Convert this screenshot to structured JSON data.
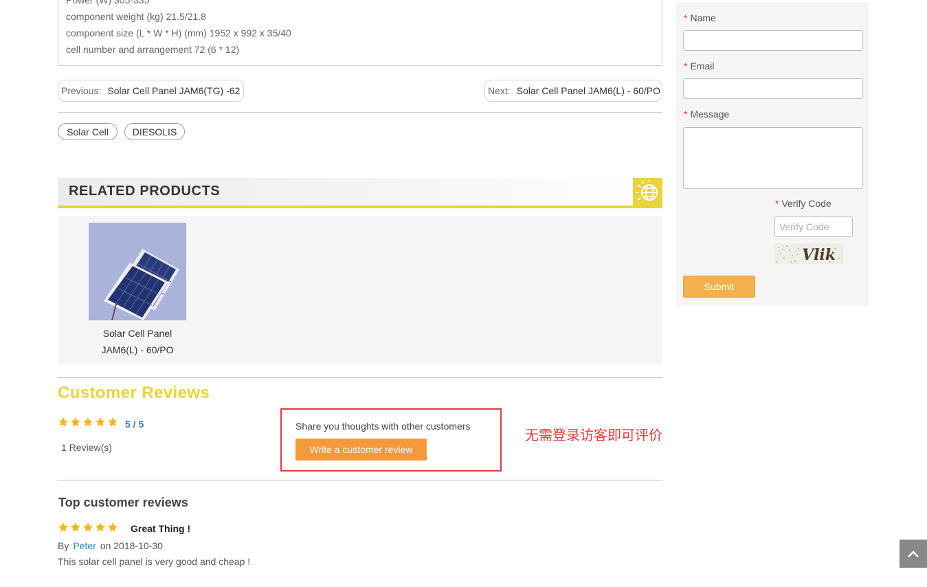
{
  "specs": [
    "Power (W) 305-335",
    "component weight (kg) 21.5/21.8",
    "component size (L * W * H) (mm) 1952 x 992 x 35/40",
    "cell number and arrangement 72 (6 * 12)"
  ],
  "pager": {
    "prev_label": "Previous:",
    "prev_title": "Solar Cell Panel JAM6(TG) -62",
    "next_label": "Next:",
    "next_title": "Solar Cell Panel JAM6(L) - 60/PO"
  },
  "tags": [
    "Solar Cell",
    "DIESOLIS"
  ],
  "related": {
    "title": "RELATED PRODUCTS",
    "products": [
      {
        "name_line1": "Solar Cell Panel",
        "name_line2": "JAM6(L) - 60/PO"
      }
    ]
  },
  "reviews": {
    "title": "Customer Reviews",
    "rating": 5,
    "score_text": "5 / 5",
    "count_text": "1  Review(s)",
    "share_text": "Share you thoughts with other customers",
    "write_button": "Write a customer review",
    "note": "无需登录访客即可评价",
    "top_title": "Top customer reviews",
    "items": [
      {
        "rating": 5,
        "headline": "Great Thing !",
        "by_prefix": "By",
        "author": "Peter",
        "date_text": "on 2018-10-30",
        "text": "This solar cell panel is very good and cheap !"
      }
    ]
  },
  "form": {
    "required_mark": "*",
    "name_label": "Name",
    "email_label": "Email",
    "message_label": "Message",
    "verify_label": "Verify Code",
    "verify_placeholder": "Verify Code",
    "captcha_text": "Vlik",
    "submit_label": "Submit"
  },
  "colors": {
    "accent_yellow": "#e9d43b",
    "star": "#f5b523",
    "button_orange": "#f59a3a",
    "link_blue": "#2a7bc4",
    "highlight_red": "#e53b3b"
  },
  "icons": {
    "related_badge": "sun-globe-icon",
    "back_to_top": "chevron-up-icon",
    "rating": "star-icon"
  }
}
